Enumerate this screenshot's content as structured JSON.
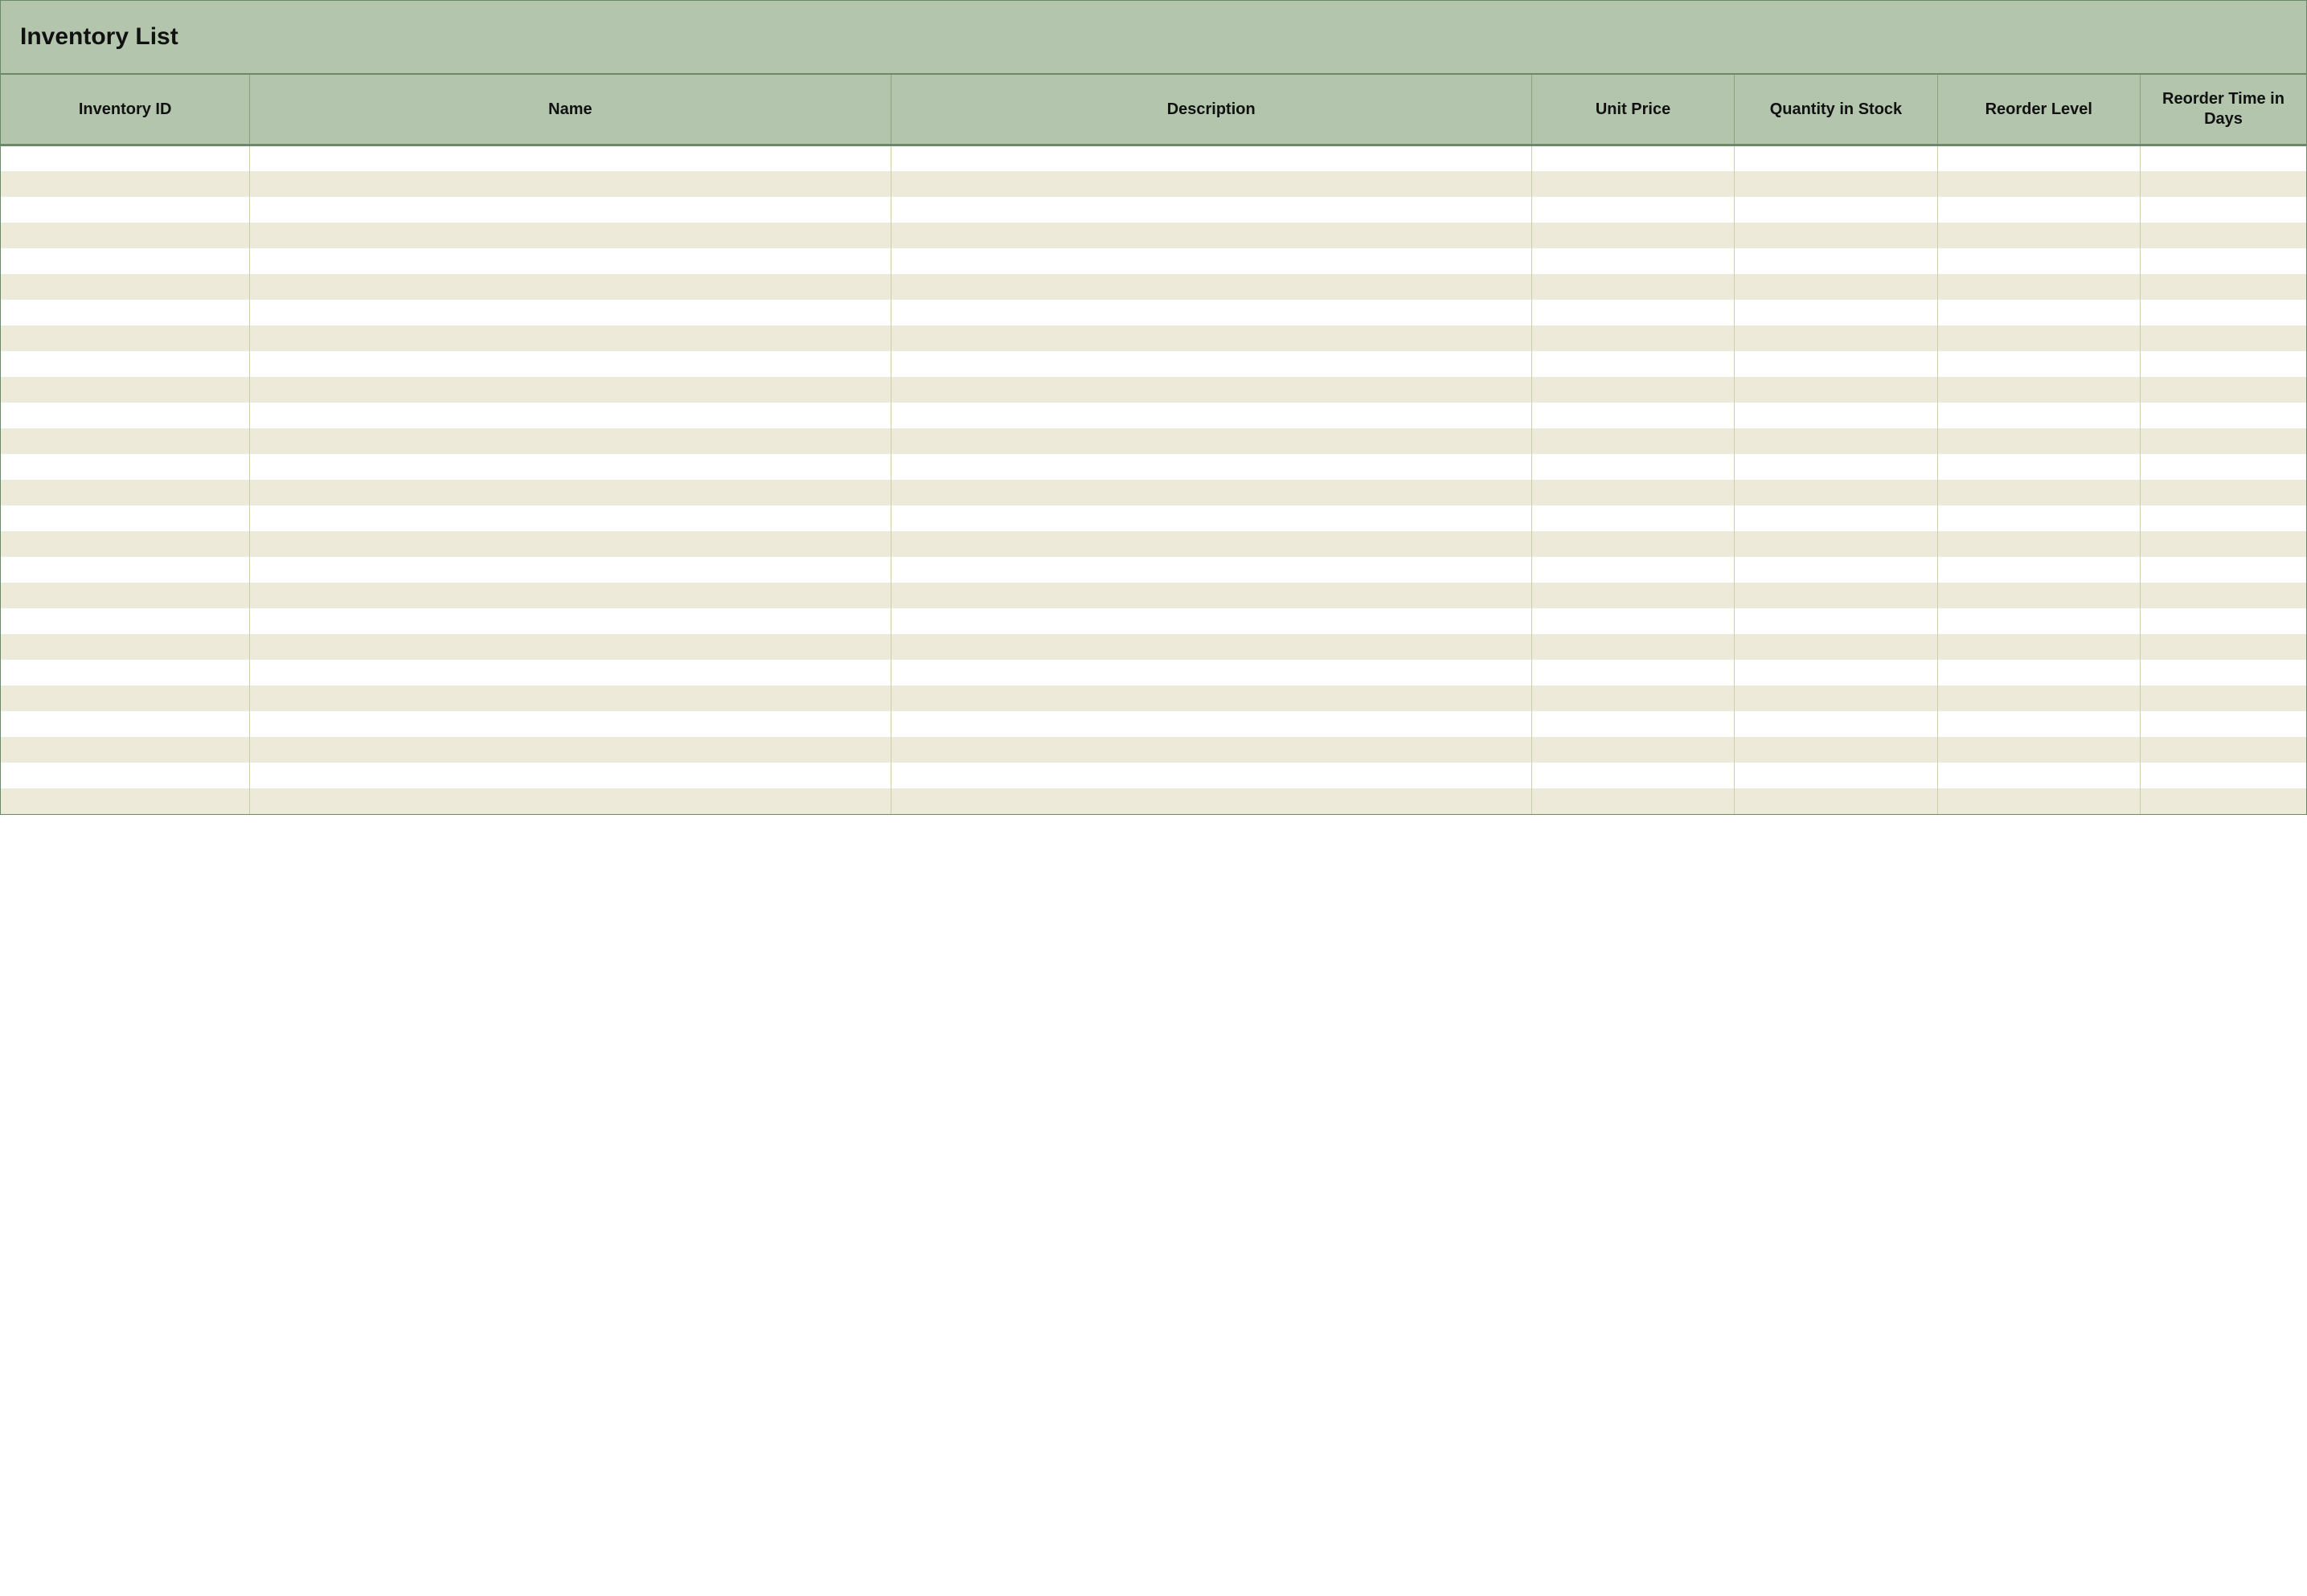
{
  "title": "Inventory List",
  "columns": [
    "Inventory ID",
    "Name",
    "Description",
    "Unit Price",
    "Quantity in Stock",
    "Reorder Level",
    "Reorder Time in Days"
  ],
  "rows": [
    [
      "",
      "",
      "",
      "",
      "",
      "",
      ""
    ],
    [
      "",
      "",
      "",
      "",
      "",
      "",
      ""
    ],
    [
      "",
      "",
      "",
      "",
      "",
      "",
      ""
    ],
    [
      "",
      "",
      "",
      "",
      "",
      "",
      ""
    ],
    [
      "",
      "",
      "",
      "",
      "",
      "",
      ""
    ],
    [
      "",
      "",
      "",
      "",
      "",
      "",
      ""
    ],
    [
      "",
      "",
      "",
      "",
      "",
      "",
      ""
    ],
    [
      "",
      "",
      "",
      "",
      "",
      "",
      ""
    ],
    [
      "",
      "",
      "",
      "",
      "",
      "",
      ""
    ],
    [
      "",
      "",
      "",
      "",
      "",
      "",
      ""
    ],
    [
      "",
      "",
      "",
      "",
      "",
      "",
      ""
    ],
    [
      "",
      "",
      "",
      "",
      "",
      "",
      ""
    ],
    [
      "",
      "",
      "",
      "",
      "",
      "",
      ""
    ],
    [
      "",
      "",
      "",
      "",
      "",
      "",
      ""
    ],
    [
      "",
      "",
      "",
      "",
      "",
      "",
      ""
    ],
    [
      "",
      "",
      "",
      "",
      "",
      "",
      ""
    ],
    [
      "",
      "",
      "",
      "",
      "",
      "",
      ""
    ],
    [
      "",
      "",
      "",
      "",
      "",
      "",
      ""
    ],
    [
      "",
      "",
      "",
      "",
      "",
      "",
      ""
    ],
    [
      "",
      "",
      "",
      "",
      "",
      "",
      ""
    ],
    [
      "",
      "",
      "",
      "",
      "",
      "",
      ""
    ],
    [
      "",
      "",
      "",
      "",
      "",
      "",
      ""
    ],
    [
      "",
      "",
      "",
      "",
      "",
      "",
      ""
    ],
    [
      "",
      "",
      "",
      "",
      "",
      "",
      ""
    ],
    [
      "",
      "",
      "",
      "",
      "",
      "",
      ""
    ],
    [
      "",
      "",
      "",
      "",
      "",
      "",
      ""
    ]
  ]
}
